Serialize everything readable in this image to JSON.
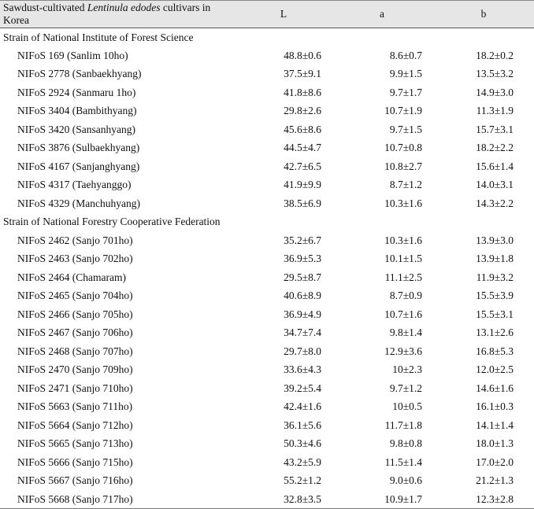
{
  "header": {
    "title_prefix": "Sawdust-cultivated ",
    "title_italic": "Lentinula edodes",
    "title_suffix": " cultivars in Korea",
    "col_L": "L",
    "col_a": "a",
    "col_b": "b"
  },
  "groups": [
    {
      "label": "Strain of National Institute of Forest Science",
      "rows": [
        {
          "name": "NIFoS 169 (Sanlim 10ho)",
          "L": "48.8±0.6",
          "a": "8.6±0.7",
          "b": "18.2±0.2"
        },
        {
          "name": "NIFoS 2778 (Sanbaekhyang)",
          "L": "37.5±9.1",
          "a": "9.9±1.5",
          "b": "13.5±3.2"
        },
        {
          "name": "NIFoS 2924 (Sanmaru 1ho)",
          "L": "41.8±8.6",
          "a": "9.7±1.7",
          "b": "14.9±3.0"
        },
        {
          "name": "NIFoS 3404 (Bambithyang)",
          "L": "29.8±2.6",
          "a": "10.7±1.9",
          "b": "11.3±1.9"
        },
        {
          "name": "NIFoS 3420 (Sansanhyang)",
          "L": "45.6±8.6",
          "a": "9.7±1.5",
          "b": "15.7±3.1"
        },
        {
          "name": "NIFoS 3876 (Sulbaekhyang)",
          "L": "44.5±4.7",
          "a": "10.7±0.8",
          "b": "18.2±2.2"
        },
        {
          "name": "NIFoS 4167 (Sanjanghyang)",
          "L": "42.7±6.5",
          "a": "10.8±2.7",
          "b": "15.6±1.4"
        },
        {
          "name": "NIFoS 4317 (Taehyanggo)",
          "L": "41.9±9.9",
          "a": "8.7±1.2",
          "b": "14.0±3.1"
        },
        {
          "name": "NIFoS 4329 (Manchuhyang)",
          "L": "38.5±6.9",
          "a": "10.3±1.6",
          "b": "14.3±2.2"
        }
      ]
    },
    {
      "label": "Strain of National Forestry Cooperative Federation",
      "rows": [
        {
          "name": "NIFoS 2462 (Sanjo 701ho)",
          "L": "35.2±6.7",
          "a": "10.3±1.6",
          "b": "13.9±3.0"
        },
        {
          "name": "NIFoS 2463 (Sanjo 702ho)",
          "L": "36.9±5.3",
          "a": "10.1±1.5",
          "b": "13.9±1.8"
        },
        {
          "name": "NIFoS 2464 (Chamaram)",
          "L": "29.5±8.7",
          "a": "11.1±2.5",
          "b": "11.9±3.2"
        },
        {
          "name": "NIFoS 2465 (Sanjo 704ho)",
          "L": "40.6±8.9",
          "a": "8.7±0.9",
          "b": "15.5±3.9"
        },
        {
          "name": "NIFoS 2466 (Sanjo 705ho)",
          "L": "36.9±4.9",
          "a": "10.7±1.6",
          "b": "15.5±3.1"
        },
        {
          "name": "NIFoS 2467 (Sanjo 706ho)",
          "L": "34.7±7.4",
          "a": "9.8±1.4",
          "b": "13.1±2.6"
        },
        {
          "name": "NIFoS 2468 (Sanjo 707ho)",
          "L": "29.7±8.0",
          "a": "12.9±3.6",
          "b": "16.8±5.3"
        },
        {
          "name": "NIFoS 2470 (Sanjo 709ho)",
          "L": "33.6±4.3",
          "a": "10±2.3",
          "b": "12.0±2.5"
        },
        {
          "name": "NIFoS 2471 (Sanjo 710ho)",
          "L": "39.2±5.4",
          "a": "9.7±1.2",
          "b": "14.6±1.6"
        },
        {
          "name": "NIFoS 5663 (Sanjo 711ho)",
          "L": "42.4±1.6",
          "a": "10±0.5",
          "b": "16.1±0.3"
        },
        {
          "name": "NIFoS 5664 (Sanjo 712ho)",
          "L": "36.1±5.6",
          "a": "11.7±1.8",
          "b": "14.1±1.4"
        },
        {
          "name": "NIFoS 5665 (Sanjo 713ho)",
          "L": "50.3±4.6",
          "a": "9.8±0.8",
          "b": "18.0±1.3"
        },
        {
          "name": "NIFoS 5666 (Sanjo 715ho)",
          "L": "43.2±5.9",
          "a": "11.5±1.4",
          "b": "17.0±2.0"
        },
        {
          "name": "NIFoS 5667 (Sanjo 716ho)",
          "L": "55.2±1.2",
          "a": "9.0±0.6",
          "b": "21.2±1.3"
        },
        {
          "name": "NIFoS 5668 (Sanjo 717ho)",
          "L": "32.8±3.5",
          "a": "10.9±1.7",
          "b": "12.3±2.8"
        }
      ]
    }
  ]
}
